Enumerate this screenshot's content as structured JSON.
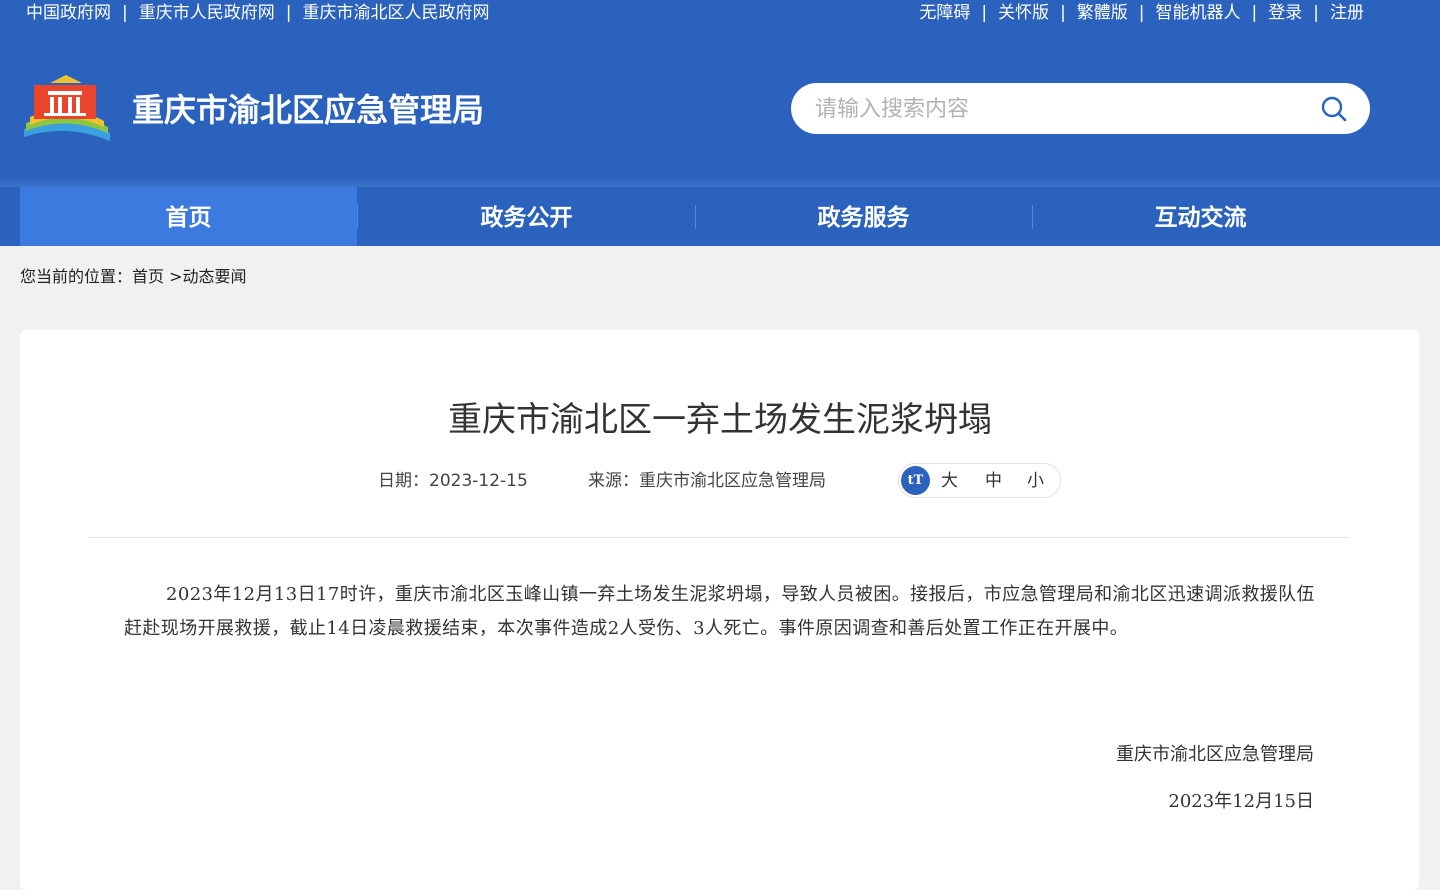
{
  "top_links": {
    "left": [
      "中国政府网",
      "重庆市人民政府网",
      "重庆市渝北区人民政府网"
    ],
    "right": [
      "无障碍",
      "关怀版",
      "繁體版",
      "智能机器人",
      "登录",
      "注册"
    ]
  },
  "header": {
    "site_title": "重庆市渝北区应急管理局",
    "search_placeholder": "请输入搜索内容"
  },
  "nav": [
    "首页",
    "政务公开",
    "政务服务",
    "互动交流"
  ],
  "breadcrumb": {
    "prefix": "您当前的位置：",
    "home": "首页",
    "arrow": ">",
    "current": "动态要闻"
  },
  "article": {
    "title": "重庆市渝北区一弃土场发生泥浆坍塌",
    "date_label": "日期：",
    "date": "2023-12-15",
    "source_label": "来源：",
    "source": "重庆市渝北区应急管理局",
    "font_sizes": [
      "大",
      "中",
      "小"
    ],
    "font_icon_text": "tT",
    "body": "2023年12月13日17时许，重庆市渝北区玉峰山镇一弃土场发生泥浆坍塌，导致人员被困。接报后，市应急管理局和渝北区迅速调派救援队伍赶赴现场开展救援，截止14日凌晨救援结束，本次事件造成2人受伤、3人死亡。事件原因调查和善后处置工作正在开展中。",
    "sign_org": "重庆市渝北区应急管理局",
    "sign_date": "2023年12月15日"
  },
  "colors": {
    "header_blue": "#2a62bd",
    "nav_active": "#3d7ae0"
  }
}
